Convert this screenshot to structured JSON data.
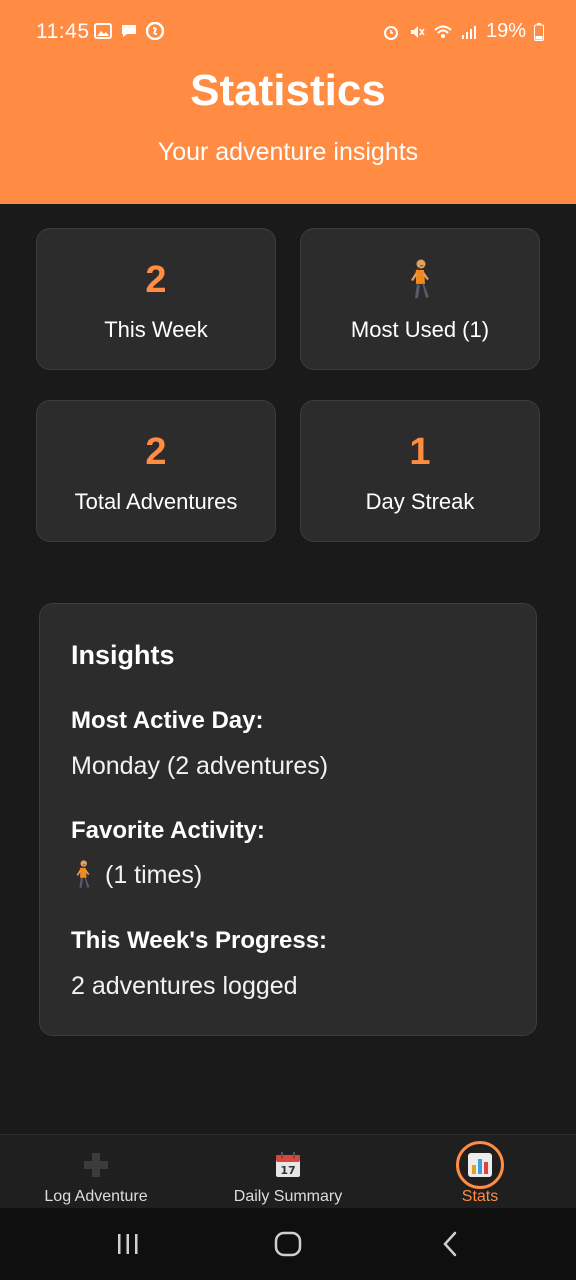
{
  "status_bar": {
    "time": "11:45",
    "battery": "19%"
  },
  "header": {
    "title": "Statistics",
    "subtitle": "Your adventure insights"
  },
  "stats": [
    {
      "value": "2",
      "label": "This Week"
    },
    {
      "value": "",
      "label": "Most Used (1)",
      "icon": "person-walking-icon"
    },
    {
      "value": "2",
      "label": "Total Adventures"
    },
    {
      "value": "1",
      "label": "Day Streak"
    }
  ],
  "insights": {
    "title": "Insights",
    "most_active_day_heading": "Most Active Day:",
    "most_active_day_value": "Monday (2 adventures)",
    "favorite_activity_heading": "Favorite Activity:",
    "favorite_activity_value": "(1 times)",
    "progress_heading": "This Week's Progress:",
    "progress_value": "2 adventures logged"
  },
  "bottom_nav": [
    {
      "label": "Log Adventure",
      "icon": "plus-icon",
      "active": false
    },
    {
      "label": "Daily Summary",
      "icon": "calendar-icon",
      "active": false
    },
    {
      "label": "Stats",
      "icon": "bar-chart-icon",
      "active": true
    }
  ],
  "colors": {
    "accent": "#ff8c42",
    "background": "#1a1a1a",
    "card": "#2c2c2c"
  }
}
